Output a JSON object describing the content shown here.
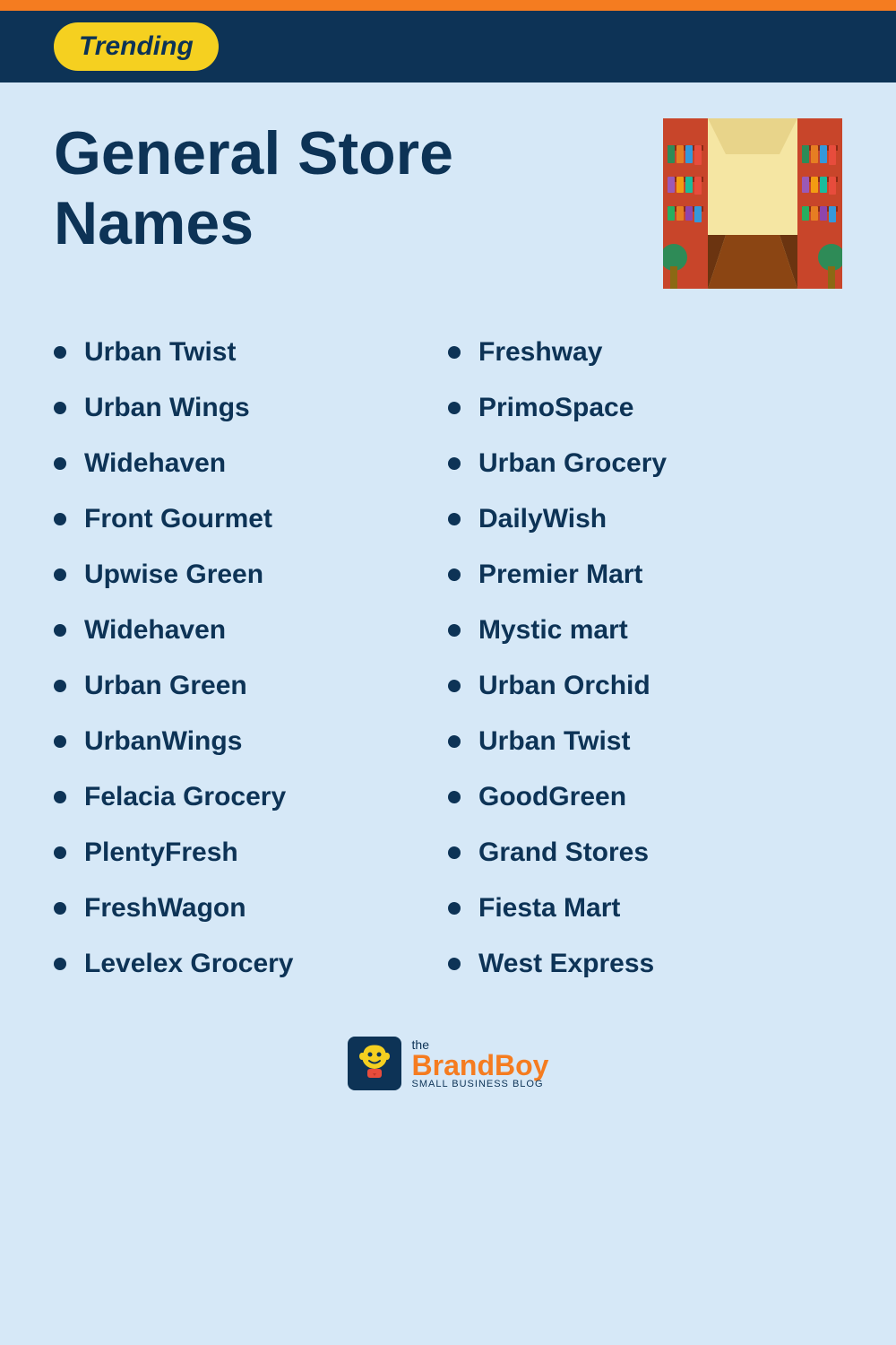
{
  "topBar": {
    "color": "#f57c20"
  },
  "header": {
    "trendingLabel": "Trending"
  },
  "pageTitle": {
    "line1": "General Store",
    "line2": "Names"
  },
  "leftColumn": [
    "Urban Twist",
    "Urban Wings",
    "Widehaven",
    "Front Gourmet",
    "Upwise Green",
    "Widehaven",
    "Urban Green",
    "UrbanWings",
    "Felacia Grocery",
    "PlentyFresh",
    "FreshWagon",
    "Levelex Grocery"
  ],
  "rightColumn": [
    "Freshway",
    "PrimoSpace",
    "Urban Grocery",
    "DailyWish",
    "Premier Mart",
    "Mystic mart",
    "Urban Orchid",
    "Urban Twist",
    "GoodGreen",
    "Grand Stores",
    "Fiesta Mart",
    "West Express"
  ],
  "footer": {
    "the": "the",
    "brandPart1": "Brand",
    "brandPart2": "Boy",
    "tagline": "SMALL BUSINESS BLOG"
  }
}
